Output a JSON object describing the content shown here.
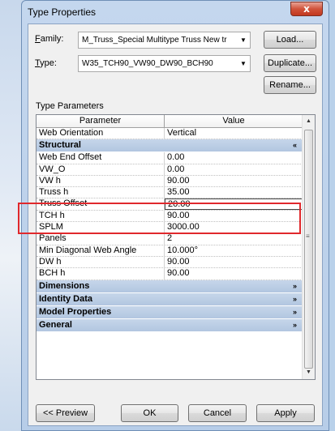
{
  "window": {
    "title": "Type Properties",
    "close_glyph": "x"
  },
  "family": {
    "label_first": "F",
    "label_rest": "amily:",
    "value": "M_Truss_Special Multitype Truss New tr",
    "load_button": "Load..."
  },
  "type": {
    "label_first": "T",
    "label_rest": "ype:",
    "value": "W35_TCH90_VW90_DW90_BCH90",
    "duplicate_button": "Duplicate...",
    "rename_button": "Rename..."
  },
  "type_parameters": {
    "title": "Type Parameters",
    "columns": [
      "Parameter",
      "Value"
    ],
    "top_row": {
      "param": "Web Orientation",
      "value": "Vertical"
    },
    "structural_group": "Structural",
    "structural_rows": [
      {
        "param": "Web End Offset",
        "value": "0.00"
      },
      {
        "param": "VW_O",
        "value": "0.00"
      },
      {
        "param": "VW h",
        "value": "90.00"
      },
      {
        "param": "Truss h",
        "value": "35.00"
      },
      {
        "param": "Truss Offset",
        "value": "20.00"
      },
      {
        "param": "TCH h",
        "value": "90.00"
      },
      {
        "param": "SPLM",
        "value": "3000.00"
      },
      {
        "param": "Panels",
        "value": "2"
      },
      {
        "param": "Min Diagonal Web Angle",
        "value": "10.000°"
      },
      {
        "param": "DW h",
        "value": "90.00"
      },
      {
        "param": "BCH h",
        "value": "90.00"
      }
    ],
    "collapsed_groups": [
      "Dimensions",
      "Identity Data",
      "Model Properties",
      "General"
    ]
  },
  "footer": {
    "preview_button": "<< Preview",
    "ok_button": "OK",
    "cancel_button": "Cancel",
    "apply_button": "Apply"
  }
}
